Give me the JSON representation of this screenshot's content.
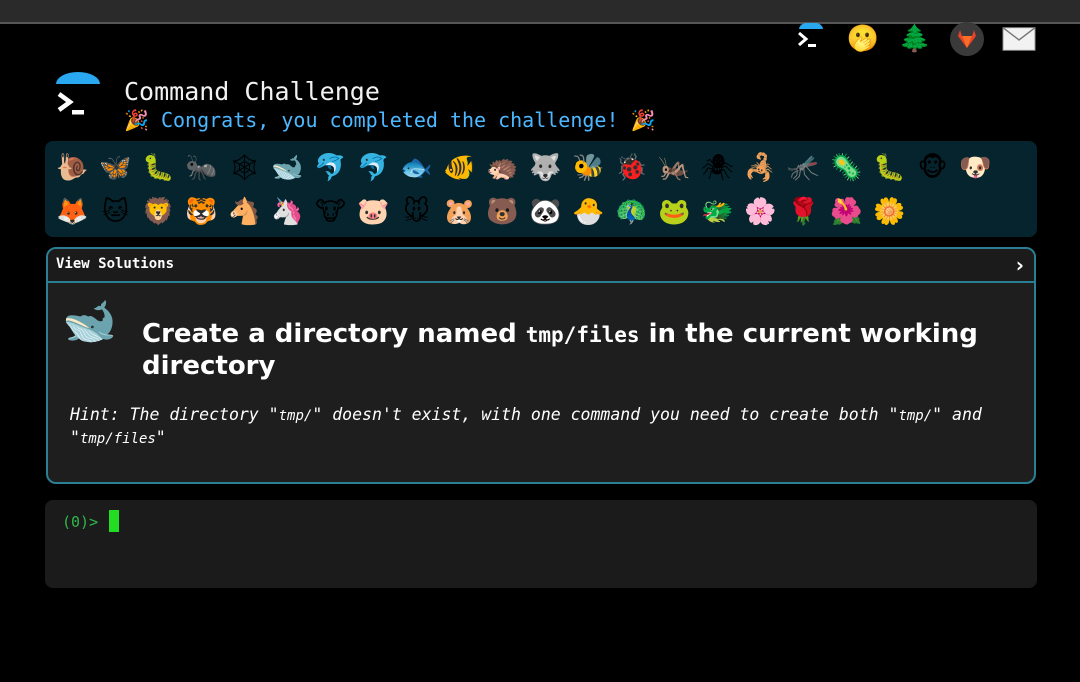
{
  "header": {
    "title": "Command Challenge",
    "congrats": "Congrats, you completed the challenge!",
    "party_icon": "party-popper-icon",
    "nav_icons": [
      "terminal-logo-icon",
      "hushed-face-icon",
      "tree-icon",
      "gitlab-icon",
      "mail-icon"
    ]
  },
  "animals": [
    "🐌",
    "🦋",
    "🐛",
    "🐜",
    "🕸",
    "🐋",
    "🐬",
    "🐬",
    "🐟",
    "🐠",
    "🦔",
    "🐺",
    "🐝",
    "🐞",
    "🦗",
    "🕷",
    "🦂",
    "🦟",
    "🦠",
    "🐛",
    "🐵",
    "🐶",
    "🦊",
    "🐱",
    "🦁",
    "🐯",
    "🐴",
    "🦄",
    "🐮",
    "🐷",
    "🐭",
    "🐹",
    "🐻",
    "🐼",
    "🐣",
    "🦚",
    "🐸",
    "🐲",
    "🌸",
    "🌹",
    "🌺",
    "🌼"
  ],
  "solutions": {
    "header_label": "View Solutions",
    "chevron": "›"
  },
  "challenge": {
    "level_icon": "whale-icon",
    "task_pre": "Create a directory named ",
    "task_code": "tmp/files",
    "task_post": " in the current working directory",
    "hint_1": "Hint: The directory \"",
    "hint_code_1": "tmp/",
    "hint_2": "\" doesn't exist, with one command you need to create both \"",
    "hint_code_2": "tmp/",
    "hint_3": "\" and \"",
    "hint_code_3": "tmp/files",
    "hint_4": "\""
  },
  "terminal": {
    "prompt": "(0)>"
  },
  "colors": {
    "accent": "#4db8ff",
    "panel_border": "#2b7f94",
    "animal_strip": "#06242e",
    "prompt_green": "#2fb84a"
  }
}
